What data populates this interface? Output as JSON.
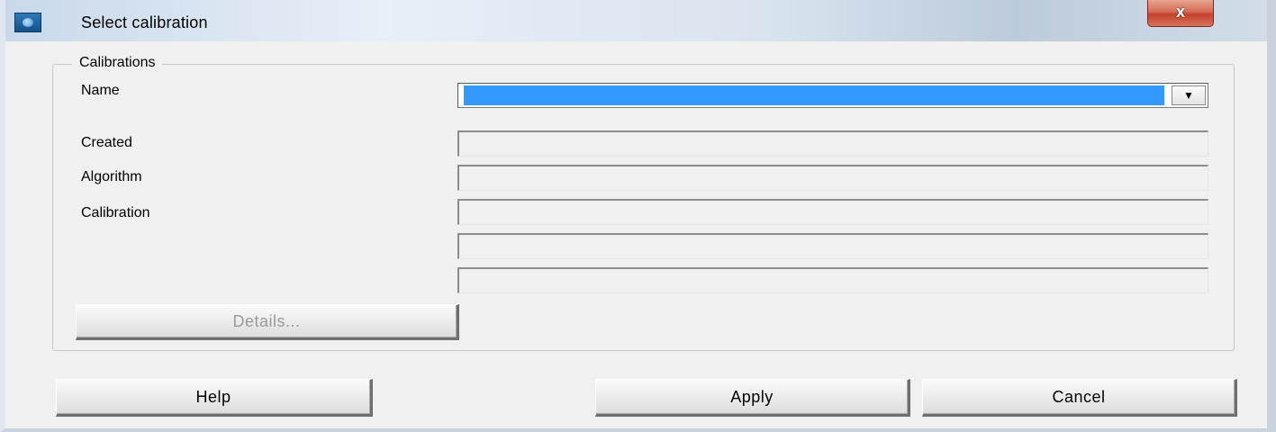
{
  "window": {
    "title": "Select calibration",
    "close_glyph": "x",
    "icon": "app-icon"
  },
  "calibrations": {
    "legend": "Calibrations",
    "name_label": "Name",
    "name_value": "",
    "dropdown_glyph": "▼",
    "created_label": "Created",
    "created_value": "",
    "algorithm_label": "Algorithm",
    "algorithm_value": "",
    "calibration_label": "Calibration",
    "calibration_lines": [
      "",
      "",
      ""
    ],
    "details_label": "Details..."
  },
  "buttons": {
    "help_label": "Help",
    "apply_label": "Apply",
    "cancel_label": "Cancel"
  },
  "colors": {
    "selection": "#3399ff",
    "close_button": "#c94b34",
    "disabled_text": "#9a9a9a"
  }
}
